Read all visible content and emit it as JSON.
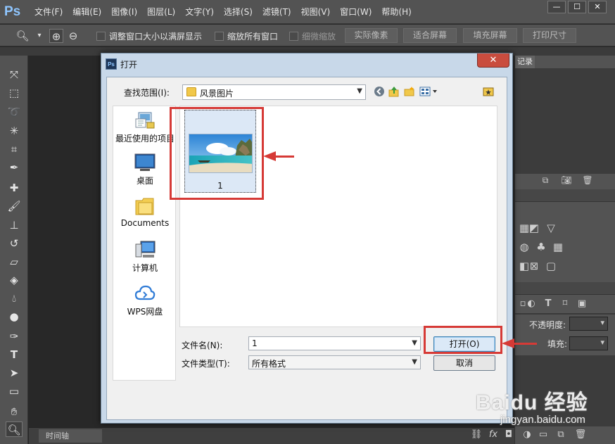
{
  "app": {
    "logo": "Ps",
    "menus": [
      "文件(F)",
      "编辑(E)",
      "图像(I)",
      "图层(L)",
      "文字(Y)",
      "选择(S)",
      "滤镜(T)",
      "视图(V)",
      "窗口(W)",
      "帮助(H)"
    ],
    "window_buttons": [
      "—",
      "☐",
      "✕"
    ]
  },
  "options_bar": {
    "fit_window": "调整窗口大小以满屏显示",
    "zoom_all": "缩放所有窗口",
    "scrubby": "细微缩放",
    "actual_pixels": "实际像素",
    "fit_screen": "适合屏幕",
    "fill_screen": "填充屏幕",
    "print_size": "打印尺寸"
  },
  "panels": {
    "history_tab": "记录",
    "opacity_label": "不透明度:",
    "fill_label": "填充:",
    "timeline_tab": "时间轴"
  },
  "dialog": {
    "icon_text": "Ps",
    "title": "打开",
    "close": "✕",
    "look_in_label": "查找范围(I):",
    "look_in_value": "风景图片",
    "places": [
      {
        "label": "最近使用的项目",
        "icon": "recent-items-icon"
      },
      {
        "label": "桌面",
        "icon": "desktop-icon"
      },
      {
        "label": "Documents",
        "icon": "documents-folder-icon"
      },
      {
        "label": "计算机",
        "icon": "computer-icon"
      },
      {
        "label": "WPS网盘",
        "icon": "wps-cloud-icon"
      }
    ],
    "files": [
      {
        "name": "1",
        "icon": "beach-thumbnail"
      }
    ],
    "filename_label": "文件名(N):",
    "filename_value": "1",
    "filetype_label": "文件类型(T):",
    "filetype_value": "所有格式",
    "open_button": "打开(O)",
    "cancel_button": "取消"
  },
  "watermark": {
    "logo": "Baidu 经验",
    "url": "jingyan.baidu.com"
  },
  "colors": {
    "annotation": "#d63a36",
    "ps_chrome": "#535353",
    "dialog_frame": "#c8d8e9"
  }
}
